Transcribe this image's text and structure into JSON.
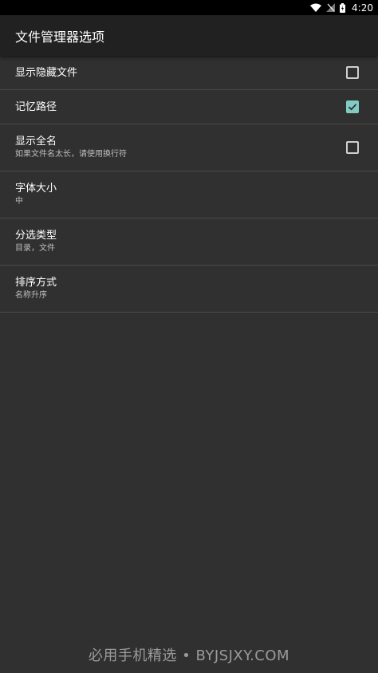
{
  "status_bar": {
    "time": "4:20",
    "icons": [
      "wifi-icon",
      "signal-off-icon",
      "battery-icon"
    ]
  },
  "toolbar": {
    "title": "文件管理器选项"
  },
  "preferences": [
    {
      "title": "显示隐藏文件",
      "summary": "",
      "type": "checkbox",
      "checked": false
    },
    {
      "title": "记忆路径",
      "summary": "",
      "type": "checkbox",
      "checked": true
    },
    {
      "title": "显示全名",
      "summary": "如果文件名太长，请使用换行符",
      "type": "checkbox",
      "checked": false
    },
    {
      "title": "字体大小",
      "summary": "中",
      "type": "list"
    },
    {
      "title": "分选类型",
      "summary": "目录，文件",
      "type": "list"
    },
    {
      "title": "排序方式",
      "summary": "名称升序",
      "type": "list"
    }
  ],
  "watermark": "必用手机精选 • BYJSJXY.COM",
  "colors": {
    "accent": "#80cbc4",
    "background": "#303030",
    "toolbar": "#212121",
    "status_bar": "#000000"
  }
}
